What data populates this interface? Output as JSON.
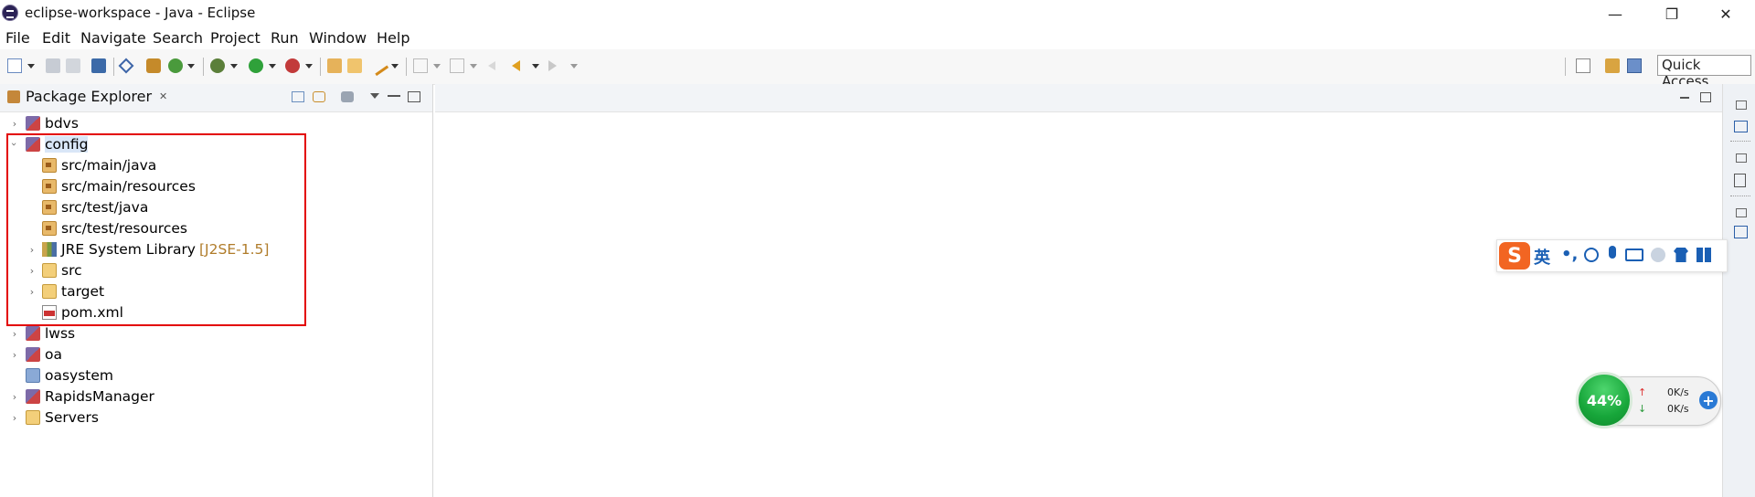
{
  "window": {
    "title": "eclipse-workspace - Java - Eclipse",
    "minimize_glyph": "—",
    "restore_glyph": "❐",
    "close_glyph": "✕"
  },
  "menu": [
    {
      "label": "File"
    },
    {
      "label": "Edit"
    },
    {
      "label": "Navigate"
    },
    {
      "label": "Search"
    },
    {
      "label": "Project"
    },
    {
      "label": "Run"
    },
    {
      "label": "Window"
    },
    {
      "label": "Help"
    }
  ],
  "toolbar": {
    "quick_access": "Quick Access"
  },
  "package_explorer": {
    "tab_label": "Package Explorer",
    "tab_close": "✕",
    "items": [
      {
        "label": "bdvs",
        "icon": "maven-project-icon",
        "expanded": false
      },
      {
        "label": "config",
        "icon": "maven-project-icon",
        "expanded": true,
        "selected": true
      },
      {
        "label": "src/main/java",
        "icon": "source-folder-icon"
      },
      {
        "label": "src/main/resources",
        "icon": "source-folder-icon"
      },
      {
        "label": "src/test/java",
        "icon": "source-folder-icon"
      },
      {
        "label": "src/test/resources",
        "icon": "source-folder-icon"
      },
      {
        "label": "JRE System Library",
        "extra": "[J2SE-1.5]",
        "icon": "library-icon"
      },
      {
        "label": "src",
        "icon": "folder-icon"
      },
      {
        "label": "target",
        "icon": "folder-icon"
      },
      {
        "label": "pom.xml",
        "icon": "xml-file-icon"
      },
      {
        "label": "lwss",
        "icon": "maven-project-icon"
      },
      {
        "label": "oa",
        "icon": "maven-project-icon"
      },
      {
        "label": "oasystem",
        "icon": "project-icon"
      },
      {
        "label": "RapidsManager",
        "icon": "maven-project-icon"
      },
      {
        "label": "Servers",
        "icon": "folder-icon"
      }
    ]
  },
  "ime_bar": {
    "logo": "S",
    "mode": "英",
    "punct": "•,"
  },
  "net_monitor": {
    "percent": "44%",
    "up_speed": "0K/s",
    "down_speed": "0K/s",
    "up_arrow": "↑",
    "down_arrow": "↓",
    "plus": "+"
  },
  "colors": {
    "highlight_border": "#e30000",
    "ime_logo": "#f26522",
    "monitor_green": "#17a63a"
  }
}
